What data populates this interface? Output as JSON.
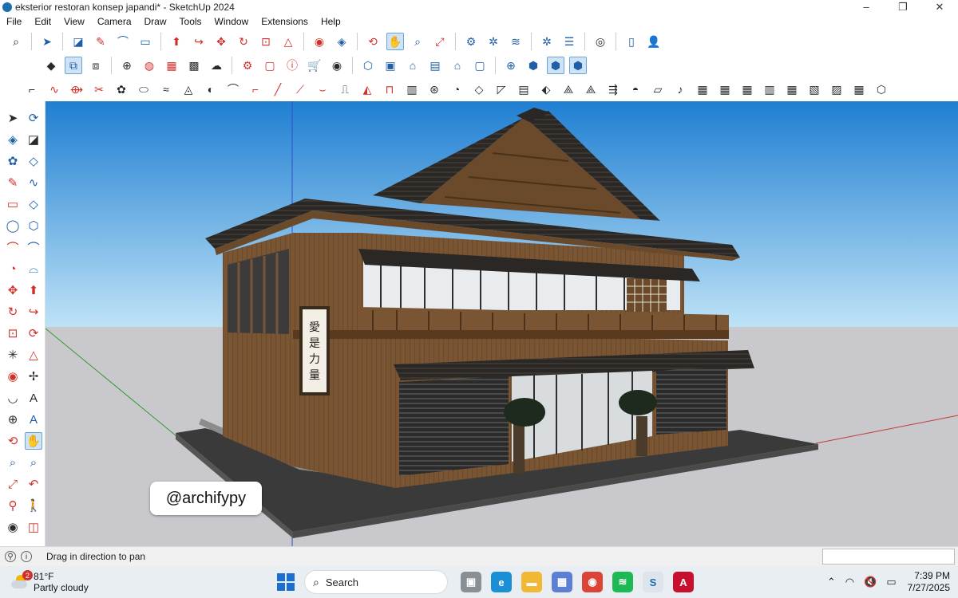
{
  "window": {
    "title": "eksterior restoran konsep japandi* - SketchUp 2024",
    "controls": [
      "–",
      "❐",
      "✕"
    ]
  },
  "menu": [
    "File",
    "Edit",
    "View",
    "Camera",
    "Draw",
    "Tools",
    "Window",
    "Extensions",
    "Help"
  ],
  "toolbar": {
    "active_tool": "pan"
  },
  "viewport": {
    "sign_text": [
      "愛",
      "是",
      "力",
      "量"
    ],
    "colors": {
      "sky_top": "#1f7fd2",
      "sky_bottom": "#bfe3f7",
      "ground": "#c9c9cd",
      "wood": "#7a5534",
      "roof": "#2a2724"
    }
  },
  "watermark": "@archifypy",
  "status": {
    "message": "Drag in direction to pan"
  },
  "taskbar": {
    "weather_temp": "81°F",
    "weather_desc": "Partly cloudy",
    "weather_badge": "2",
    "search_label": "Search",
    "time": "7:39 PM",
    "date": "7/27/2025"
  }
}
